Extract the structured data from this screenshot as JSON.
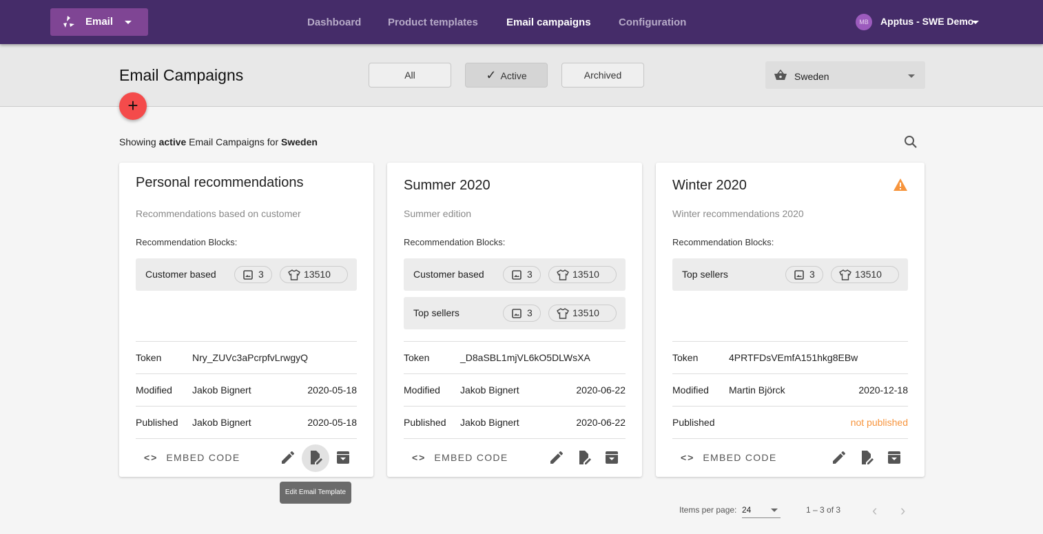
{
  "header": {
    "app_label": "Email",
    "nav": [
      "Dashboard",
      "Product templates",
      "Email campaigns",
      "Configuration"
    ],
    "active_nav": 2,
    "avatar": "MB",
    "account": "Apptus - SWE Demo"
  },
  "toolbar": {
    "title": "Email Campaigns",
    "filters": [
      "All",
      "Active",
      "Archived"
    ],
    "active_filter": 1,
    "country": "Sweden",
    "add_label": "+"
  },
  "summary": {
    "prefix": "Showing ",
    "state": "active",
    "middle": " Email Campaigns for ",
    "country": "Sweden"
  },
  "labels": {
    "rec_blocks": "Recommendation Blocks:",
    "token": "Token",
    "modified": "Modified",
    "published": "Published",
    "embed": "EMBED CODE"
  },
  "campaigns": [
    {
      "title": "Personal recommendations",
      "description": "Recommendations based on customer",
      "warning": false,
      "blocks": [
        {
          "name": "Customer based",
          "images": "3",
          "products": "13510"
        }
      ],
      "token": "Nry_ZUVc3aPcrpfvLrwgyQ",
      "modified_by": "Jakob Bignert",
      "modified": "2020-05-18",
      "published_by": "Jakob Bignert",
      "published": "2020-05-18"
    },
    {
      "title": "Summer 2020",
      "description": "Summer edition",
      "warning": false,
      "blocks": [
        {
          "name": "Customer based",
          "images": "3",
          "products": "13510"
        },
        {
          "name": "Top sellers",
          "images": "3",
          "products": "13510"
        }
      ],
      "token": "_D8aSBL1mjVL6kO5DLWsXA",
      "modified_by": "Jakob Bignert",
      "modified": "2020-06-22",
      "published_by": "Jakob Bignert",
      "published": "2020-06-22"
    },
    {
      "title": "Winter 2020",
      "description": "Winter recommendations 2020",
      "warning": true,
      "blocks": [
        {
          "name": "Top sellers",
          "images": "3",
          "products": "13510"
        }
      ],
      "token": "4PRTFDsVEmfA151hkg8EBw",
      "modified_by": "Martin Björck",
      "modified": "2020-12-18",
      "published_by": "",
      "published": "not published"
    }
  ],
  "tooltip": "Edit Email Template",
  "pagination": {
    "label": "Items per page:",
    "per_page": "24",
    "range": "1 – 3 of 3"
  },
  "colors": {
    "header": "#452c69",
    "app_button": "#7f4594",
    "fab": "#f44b4b",
    "warning": "#f7943c",
    "not_published": "#f7943c"
  }
}
